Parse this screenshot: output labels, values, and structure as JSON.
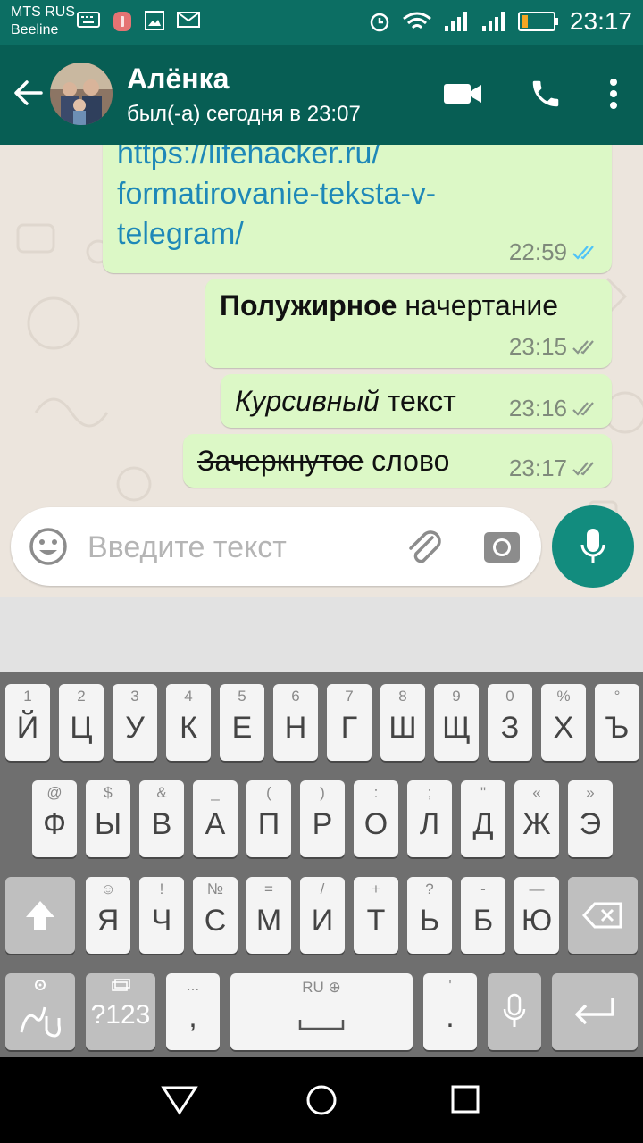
{
  "status_bar": {
    "carrier_1": "MTS RUS",
    "carrier_2": "Beeline",
    "time": "23:17"
  },
  "header": {
    "contact_name": "Алёнка",
    "contact_status": "был(-а) сегодня в 23:07"
  },
  "messages": [
    {
      "lines": [
        "https://lifehacker.ru/",
        "formatirovanie-teksta-v-",
        "telegram/"
      ],
      "time": "22:59",
      "read": true
    },
    {
      "bold": "Полужирное",
      "rest": " начертание",
      "time": "23:15",
      "read": false
    },
    {
      "italic": "Курсивный",
      "rest": " текст",
      "time": "23:16",
      "read": false
    },
    {
      "strike": "Зачеркнутое",
      "rest": " слово",
      "time": "23:17",
      "read": false
    }
  ],
  "composer": {
    "placeholder": "Введите текст"
  },
  "keyboard": {
    "row1": [
      {
        "main": "Й",
        "hint": "1"
      },
      {
        "main": "Ц",
        "hint": "2"
      },
      {
        "main": "У",
        "hint": "3"
      },
      {
        "main": "К",
        "hint": "4"
      },
      {
        "main": "Е",
        "hint": "5"
      },
      {
        "main": "Н",
        "hint": "6"
      },
      {
        "main": "Г",
        "hint": "7"
      },
      {
        "main": "Ш",
        "hint": "8"
      },
      {
        "main": "Щ",
        "hint": "9"
      },
      {
        "main": "З",
        "hint": "0"
      },
      {
        "main": "Х",
        "hint": "%"
      },
      {
        "main": "Ъ",
        "hint": "°"
      }
    ],
    "row2": [
      {
        "main": "Ф",
        "hint": "@"
      },
      {
        "main": "Ы",
        "hint": "$"
      },
      {
        "main": "В",
        "hint": "&"
      },
      {
        "main": "А",
        "hint": "_"
      },
      {
        "main": "П",
        "hint": "("
      },
      {
        "main": "Р",
        "hint": ")"
      },
      {
        "main": "О",
        "hint": ":"
      },
      {
        "main": "Л",
        "hint": ";"
      },
      {
        "main": "Д",
        "hint": "\""
      },
      {
        "main": "Ж",
        "hint": "«"
      },
      {
        "main": "Э",
        "hint": "»"
      }
    ],
    "row3": [
      {
        "main": "Я",
        "hint": "☺"
      },
      {
        "main": "Ч",
        "hint": "!"
      },
      {
        "main": "С",
        "hint": "№"
      },
      {
        "main": "М",
        "hint": "="
      },
      {
        "main": "И",
        "hint": "/"
      },
      {
        "main": "Т",
        "hint": "+"
      },
      {
        "main": "Ь",
        "hint": "?"
      },
      {
        "main": "Б",
        "hint": "-"
      },
      {
        "main": "Ю",
        "hint": "—"
      }
    ],
    "symbols_key": "?123",
    "comma_key": ",",
    "comma_hint": "...",
    "space_hint": "RU",
    "period_key": ".",
    "period_hint": "'",
    "colors": {
      "accent": "#128c7e",
      "header": "#075e54",
      "bubble": "#dcf8c6"
    }
  }
}
